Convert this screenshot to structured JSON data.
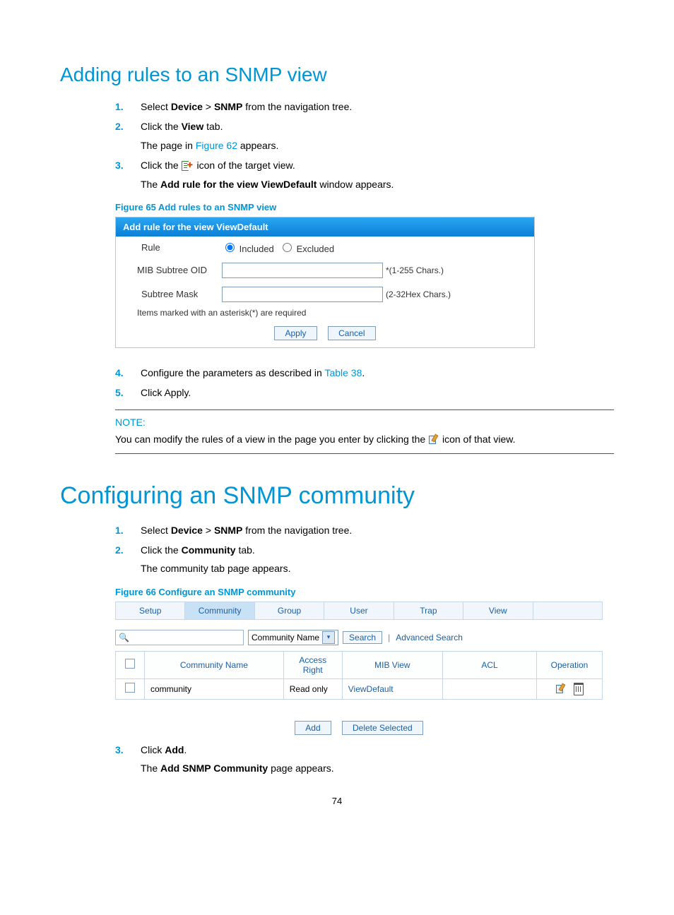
{
  "section1": {
    "title": "Adding rules to an SNMP view",
    "step1_a": "Select ",
    "step1_b": "Device",
    "step1_c": " > ",
    "step1_d": "SNMP",
    "step1_e": " from the navigation tree.",
    "step2_a": "Click the ",
    "step2_b": "View",
    "step2_c": " tab.",
    "step2_sub_a": "The page in ",
    "step2_sub_link": "Figure 62",
    "step2_sub_b": " appears.",
    "step3_a": "Click the ",
    "step3_b": " icon of the target view.",
    "step3_sub_a": "The ",
    "step3_sub_b": "Add rule for the view ViewDefault",
    "step3_sub_c": " window appears.",
    "figcap": "Figure 65 Add rules to an SNMP view"
  },
  "panel65": {
    "title": "Add rule for the view ViewDefault",
    "rule_label": "Rule",
    "rule_opt_inc": "Included",
    "rule_opt_exc": "Excluded",
    "oid_label": "MIB Subtree OID",
    "oid_hint": "*(1-255 Chars.)",
    "mask_label": "Subtree Mask",
    "mask_hint": "(2-32Hex Chars.)",
    "reqnote": "Items marked with an asterisk(*) are required",
    "apply": "Apply",
    "cancel": "Cancel"
  },
  "section1b": {
    "step4_a": "Configure the parameters as described in ",
    "step4_link": "Table 38",
    "step4_b": ".",
    "step5": "Click Apply."
  },
  "note": {
    "hdr": "NOTE:",
    "a": "You can modify the rules of a view in the page you enter by clicking the ",
    "b": " icon of that view."
  },
  "section2": {
    "title": "Configuring an SNMP community",
    "step1_a": "Select ",
    "step1_b": "Device",
    "step1_c": " > ",
    "step1_d": "SNMP",
    "step1_e": " from the navigation tree.",
    "step2_a": "Click the ",
    "step2_b": "Community",
    "step2_c": " tab.",
    "step2_sub": "The community tab page appears.",
    "figcap": "Figure 66 Configure an SNMP community"
  },
  "fig66": {
    "tabs": [
      "Setup",
      "Community",
      "Group",
      "User",
      "Trap",
      "View",
      ""
    ],
    "active_tab_index": 1,
    "search_dropdown": "Community Name",
    "search_btn": "Search",
    "adv": "Advanced Search",
    "cols": [
      "",
      "Community Name",
      "Access Right",
      "MIB View",
      "ACL",
      "Operation"
    ],
    "row": {
      "name": "community",
      "access": "Read only",
      "mib": "ViewDefault",
      "acl": ""
    },
    "add_btn": "Add",
    "del_btn": "Delete Selected"
  },
  "section2b": {
    "step3_a": "Click ",
    "step3_b": "Add",
    "step3_c": ".",
    "step3_sub_a": "The ",
    "step3_sub_b": "Add SNMP Community",
    "step3_sub_c": " page appears."
  },
  "pagenum": "74"
}
